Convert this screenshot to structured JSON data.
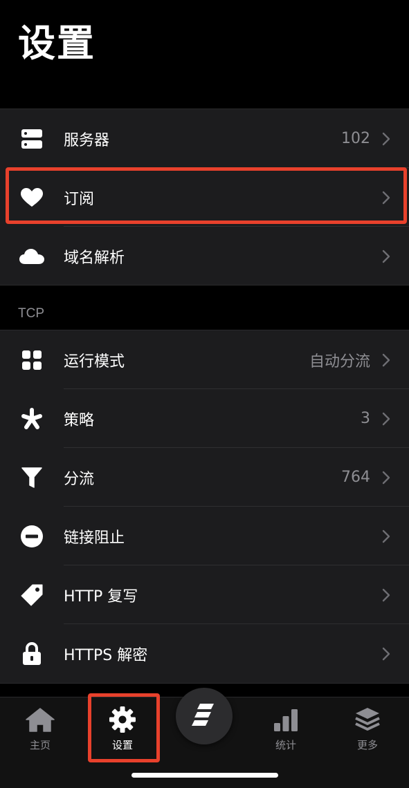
{
  "page": {
    "title": "设置"
  },
  "group1": {
    "rows": [
      {
        "icon": "server-icon",
        "label": "服务器",
        "value": "102"
      },
      {
        "icon": "heart-icon",
        "label": "订阅",
        "value": ""
      },
      {
        "icon": "cloud-icon",
        "label": "域名解析",
        "value": ""
      }
    ]
  },
  "tcp": {
    "header": "TCP",
    "rows": [
      {
        "icon": "grid-icon",
        "label": "运行模式",
        "value": "自动分流"
      },
      {
        "icon": "asterisk-icon",
        "label": "策略",
        "value": "3"
      },
      {
        "icon": "funnel-icon",
        "label": "分流",
        "value": "764"
      },
      {
        "icon": "minus-circle-icon",
        "label": "链接阻止",
        "value": ""
      },
      {
        "icon": "tag-icon",
        "label": "HTTP 复写",
        "value": ""
      },
      {
        "icon": "lock-icon",
        "label": "HTTPS 解密",
        "value": ""
      }
    ]
  },
  "tabbar": {
    "tabs": [
      {
        "icon": "home-icon",
        "label": "主页",
        "active": false
      },
      {
        "icon": "gear-icon",
        "label": "设置",
        "active": true
      },
      {
        "icon": "bar-chart-icon",
        "label": "统计",
        "active": false
      },
      {
        "icon": "layers-icon",
        "label": "更多",
        "active": false
      }
    ],
    "center_icon": "logo-icon"
  },
  "colors": {
    "background": "#000000",
    "group": "#1c1c1e",
    "secondary_text": "#8e8e93",
    "highlight": "#e8412c"
  }
}
